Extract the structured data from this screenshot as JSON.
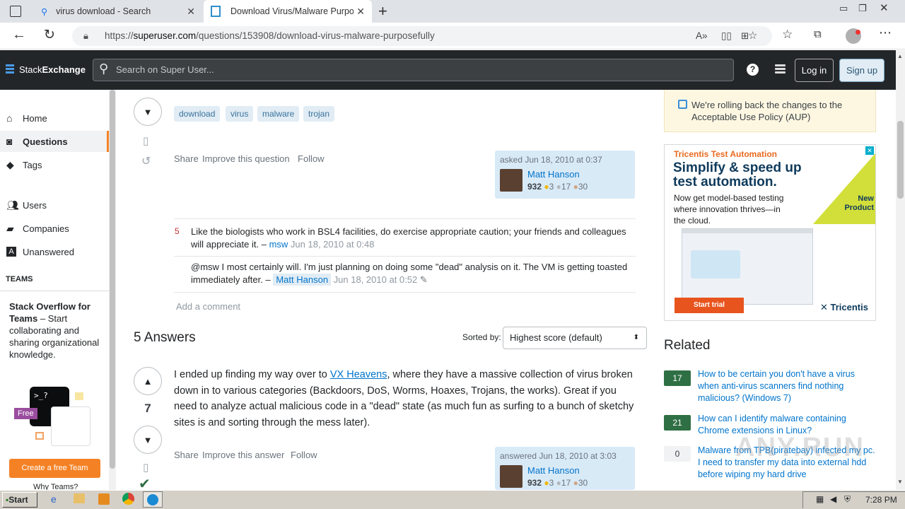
{
  "browser": {
    "tabs": [
      {
        "label": "virus download - Search",
        "active": false
      },
      {
        "label": "Download Virus/Malware Purpos",
        "active": true
      }
    ],
    "url_prefix": "https://",
    "url_host": "superuser.com",
    "url_path": "/questions/153908/download-virus-malware-purposefully"
  },
  "topbar": {
    "logo_text_1": "Stack",
    "logo_text_2": "Exchange",
    "search_placeholder": "Search on Super User...",
    "login_label": "Log in",
    "signup_label": "Sign up"
  },
  "leftnav": {
    "items": [
      {
        "label": "Home",
        "icon": "home-icon"
      },
      {
        "label": "Questions",
        "icon": "questions-icon",
        "selected": true
      },
      {
        "label": "Tags",
        "icon": "tag-icon"
      },
      {
        "label": "Users",
        "icon": "users-icon"
      },
      {
        "label": "Companies",
        "icon": "briefcase-icon"
      },
      {
        "label": "Unanswered",
        "icon": "unanswered-icon"
      }
    ],
    "teams_heading": "TEAMS",
    "teams_title": "Stack Overflow for Teams",
    "teams_text": " – Start collaborating and sharing organizational knowledge.",
    "free_badge": "Free",
    "create_team_label": "Create a free Team",
    "why_teams_label": "Why Teams?"
  },
  "question": {
    "tags": [
      "download",
      "virus",
      "malware",
      "trojan"
    ],
    "share_label": "Share",
    "improve_label": "Improve this question",
    "follow_label": "Follow",
    "asked_text": "asked Jun 18, 2010 at 0:37",
    "user_name": "Matt Hanson",
    "user_rep": "932",
    "user_gold": "3",
    "user_silver": "17",
    "user_bronze": "30"
  },
  "comments": [
    {
      "score": "5",
      "text": "Like the biologists who work in BSL4 facilities, do exercise appropriate caution; your friends and colleagues will appreciate it. –",
      "user": "msw",
      "date": "Jun 18, 2010 at 0:48"
    },
    {
      "score": "",
      "text": "@msw I most certainly will. I'm just planning on doing some \"dead\" analysis on it. The VM is getting toasted immediately after. –",
      "user": "Matt Hanson",
      "date": "Jun 18, 2010 at 0:52"
    }
  ],
  "add_comment_label": "Add a comment",
  "answers": {
    "heading": "5 Answers",
    "sorted_by_label": "Sorted by:",
    "sort_value": "Highest score (default)",
    "first": {
      "score": "7",
      "text_before": "I ended up finding my way over to ",
      "link_text": "VX Heavens",
      "text_after": ", where they have a massive collection of virus broken down in to various categories (Backdoors, DoS, Worms, Hoaxes, Trojans, the works). Great if you need to analyze actual malicious code in a \"dead\" state (as much fun as surfing to a bunch of sketchy sites is and sorting through the mess later).",
      "share_label": "Share",
      "improve_label": "Improve this answer",
      "follow_label": "Follow",
      "answered_text": "answered Jun 18, 2010 at 3:03",
      "user_name": "Matt Hanson",
      "user_rep": "932",
      "user_gold": "3",
      "user_silver": "17",
      "user_bronze": "30"
    }
  },
  "sidebar": {
    "notice": "We're rolling back the changes to the Acceptable Use Policy (AUP)",
    "ad": {
      "brand_line": "Tricentis Test Automation",
      "headline": "Simplify & speed up test automation.",
      "sub": "Now get model-based testing where innovation thrives—in the cloud.",
      "corner_1": "New",
      "corner_2": "Product",
      "cta": "Start trial",
      "logo": "Tricentis"
    },
    "related_heading": "Related",
    "related": [
      {
        "score": "17",
        "title": "How to be certain you don't have a virus when anti-virus scanners find nothing malicious? (Windows 7)",
        "answered": true
      },
      {
        "score": "21",
        "title": "How can I identify malware containing Chrome extensions in Linux?",
        "answered": true
      },
      {
        "score": "0",
        "title": "Malware from TPB(piratebay) infected my pc. I need to transfer my data into external hdd before wiping my hard drive",
        "answered": false
      }
    ]
  },
  "watermark": "ANY.RUN",
  "taskbar": {
    "start_label": "Start",
    "clock": "7:28 PM"
  }
}
